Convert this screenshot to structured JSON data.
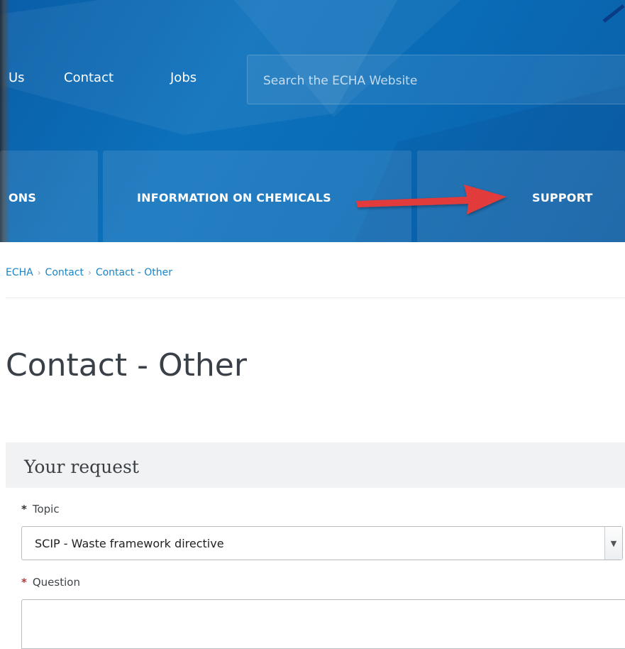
{
  "top_nav": {
    "about_partial": "Us",
    "contact": "Contact",
    "jobs": "Jobs"
  },
  "search": {
    "placeholder": "Search the ECHA Website"
  },
  "main_nav": {
    "regulations_partial": "ONS",
    "information": "INFORMATION ON CHEMICALS",
    "support": "SUPPORT"
  },
  "breadcrumb": {
    "items": [
      "ECHA",
      "Contact",
      "Contact - Other"
    ],
    "separator": "›"
  },
  "page_title": "Contact - Other",
  "form": {
    "section_title": "Your request",
    "topic": {
      "label": "Topic",
      "value": "SCIP - Waste framework directive",
      "required_mark": "*"
    },
    "question": {
      "label": "Question",
      "value": "",
      "required_mark": "*"
    }
  },
  "colors": {
    "header_blue": "#0c71bb",
    "link": "#1a84c6",
    "arrow": "#e23b3b",
    "required": "#b33a3a"
  }
}
